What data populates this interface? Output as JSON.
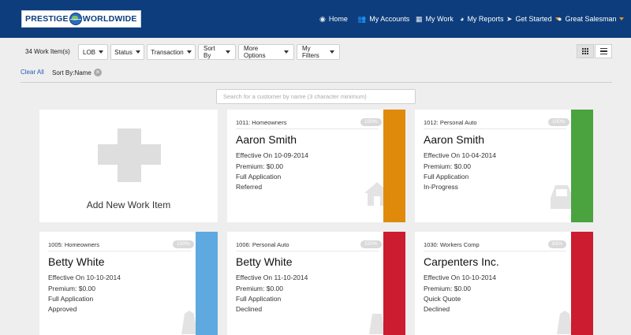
{
  "logo": {
    "left": "PRESTIGE",
    "right": "WORLDWIDE"
  },
  "nav": [
    {
      "label": "Home",
      "icon": "dashboard-icon"
    },
    {
      "label": "My Accounts",
      "icon": "users-icon"
    },
    {
      "label": "My Work",
      "icon": "grid-icon"
    },
    {
      "label": "My Reports",
      "icon": "reports-icon"
    },
    {
      "label": "Get Started",
      "icon": "rocket-icon"
    },
    {
      "label": "Great Salesman",
      "icon": "user-icon"
    }
  ],
  "toolbar": {
    "count": "34 Work Item(s)",
    "filters": [
      "LOB",
      "Status",
      "Transaction",
      "Sort By",
      "More Options",
      "My Filters"
    ],
    "clear_all": "Clear All",
    "sort_chip": "Sort By:Name"
  },
  "search": {
    "placeholder": "Search for a customer by name (3 character minimum)"
  },
  "add_card": {
    "label": "Add New Work Item"
  },
  "cards": [
    {
      "lob": "1011: Homeowners",
      "pct": "100%",
      "name": "Aaron Smith",
      "effective": "Effective On 10-09-2014",
      "premium": "Premium: $0.00",
      "transaction": "Full Application",
      "status": "Referred",
      "color": "#e08a0b",
      "icon": "house-icon"
    },
    {
      "lob": "1012: Personal Auto",
      "pct": "100%",
      "name": "Aaron Smith",
      "effective": "Effective On 10-04-2014",
      "premium": "Premium: $0.00",
      "transaction": "Full Application",
      "status": "In-Progress",
      "color": "#4aa33f",
      "icon": "car-icon"
    },
    {
      "lob": "1005: Homeowners",
      "pct": "100%",
      "name": "Betty White",
      "effective": "Effective On 10-10-2014",
      "premium": "Premium: $0.00",
      "transaction": "Full Application",
      "status": "Approved",
      "color": "#5ea9e0",
      "icon": "house-icon"
    },
    {
      "lob": "1006: Personal Auto",
      "pct": "100%",
      "name": "Betty White",
      "effective": "Effective On 11-10-2014",
      "premium": "Premium: $0.00",
      "transaction": "Full Application",
      "status": "Declined",
      "color": "#cc1c2f",
      "icon": "car-icon"
    },
    {
      "lob": "1030: Workers Comp",
      "pct": "83%",
      "name": "Carpenters Inc.",
      "effective": "Effective On 10-10-2014",
      "premium": "Premium: $0.00",
      "transaction": "Quick Quote",
      "status": "Declined",
      "color": "#cc1c2f",
      "icon": "worker-icon"
    }
  ],
  "colors": {
    "nav_bg": "#0d3d7c",
    "accent": "#e8902a",
    "link": "#1f5fb8"
  }
}
